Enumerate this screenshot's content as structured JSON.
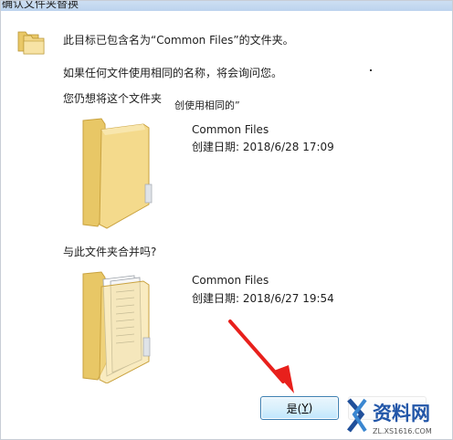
{
  "window": {
    "title": "确认文件夹替换"
  },
  "message": {
    "line1": "此目标已包含名为“Common Files”的文件夹。",
    "line2": "如果任何文件使用相同的名称，将会询问您。",
    "question1": "您仍想将这个文件夹",
    "question1_tail": "创使用相同的”",
    "question2": "与此文件夹合并吗?"
  },
  "existing_folder": {
    "name": "Common Files",
    "created": "创建日期: 2018/6/28 17:09",
    "icon": "folder-icon"
  },
  "incoming_folder": {
    "name": "Common Files",
    "created": "创建日期: 2018/6/27 19:54",
    "icon": "folder-with-files-icon"
  },
  "buttons": {
    "yes_prefix": "是(",
    "yes_key": "Y",
    "yes_suffix": ")"
  },
  "colors": {
    "arrow": "#e8201c",
    "accent": "#3c7fb1",
    "folder": "#f3d889"
  },
  "watermark": {
    "text": "资料网",
    "url": "ZL.XS1616.COM"
  }
}
